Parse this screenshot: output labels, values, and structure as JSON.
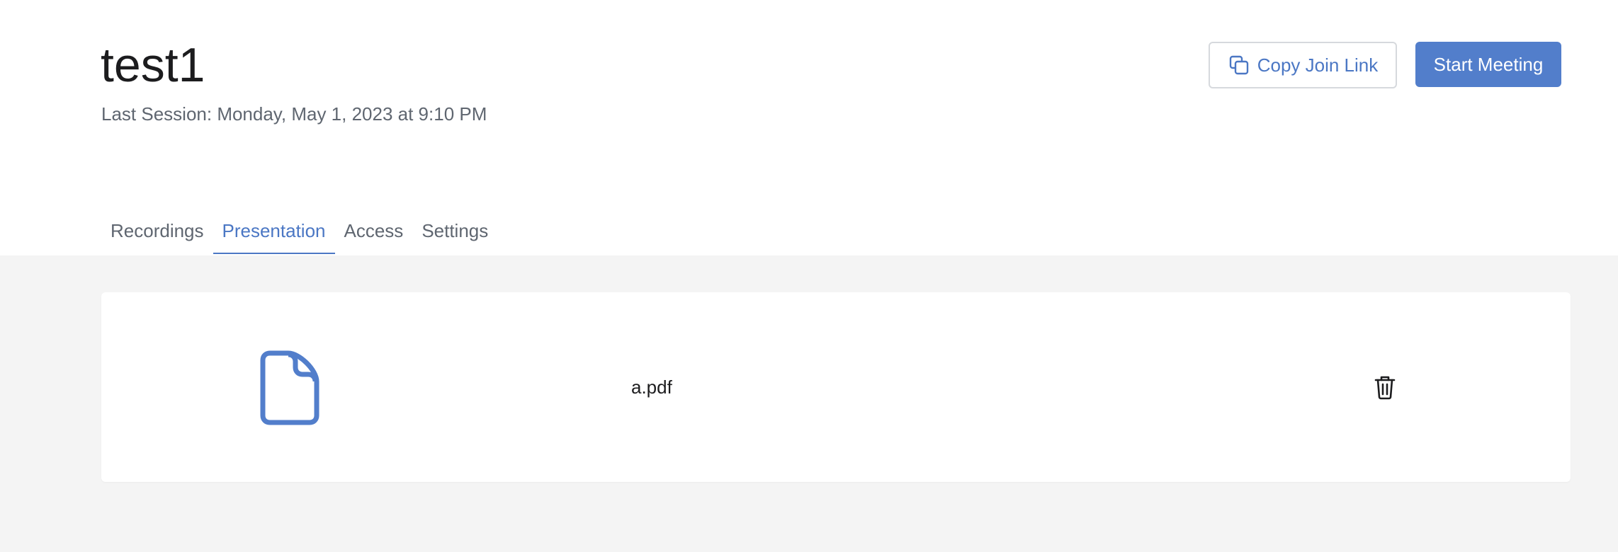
{
  "room": {
    "title": "test1",
    "last_session": "Last Session: Monday, May 1, 2023 at 9:10 PM"
  },
  "actions": {
    "copy_join_link": "Copy Join Link",
    "start_meeting": "Start Meeting"
  },
  "tabs": [
    {
      "label": "Recordings",
      "active": false
    },
    {
      "label": "Presentation",
      "active": true
    },
    {
      "label": "Access",
      "active": false
    },
    {
      "label": "Settings",
      "active": false
    }
  ],
  "presentation": {
    "file_name": "a.pdf",
    "file_icon": "document-icon",
    "delete_icon": "trash-icon"
  },
  "colors": {
    "accent": "#527ecb",
    "link": "#4b77c4",
    "muted_text": "#5f6670",
    "content_bg": "#f4f4f4"
  }
}
